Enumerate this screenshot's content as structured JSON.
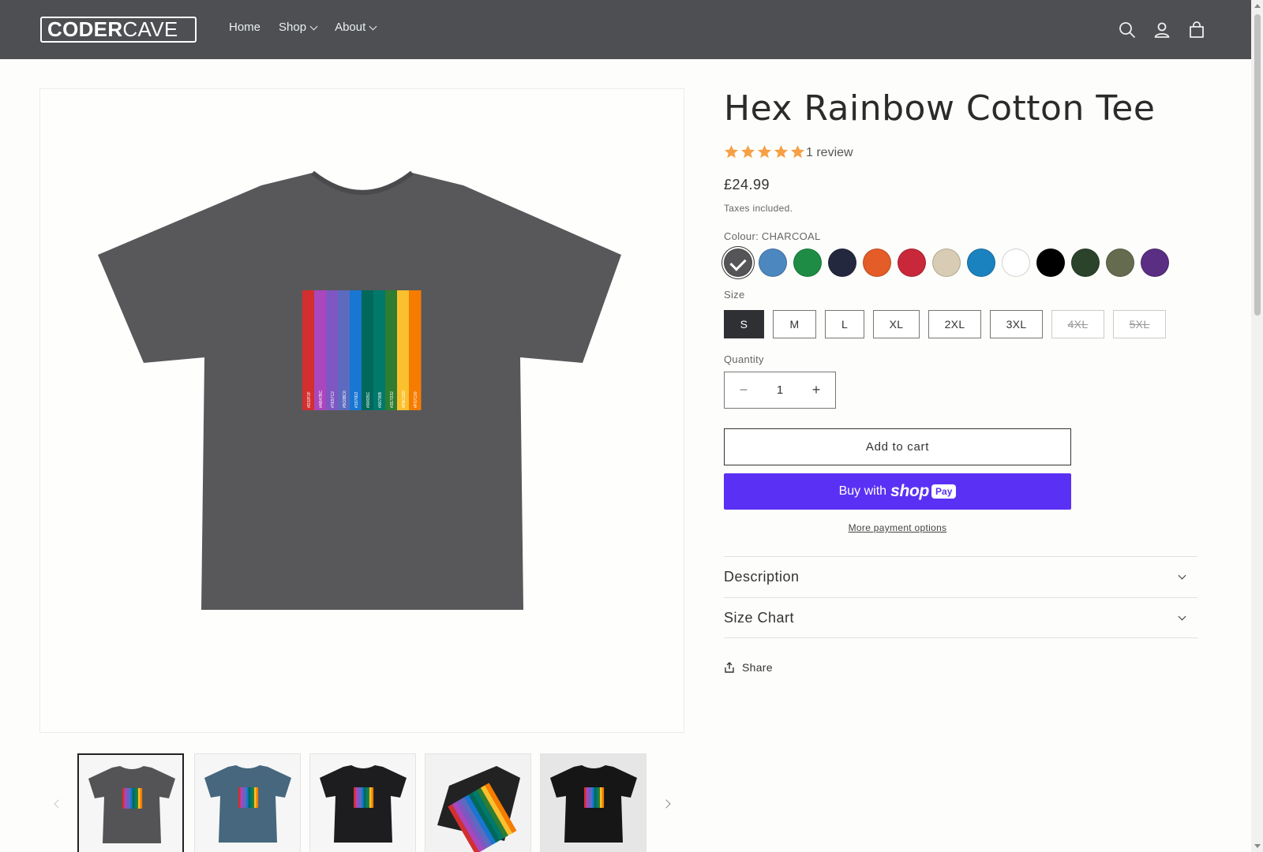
{
  "header": {
    "logo_bold": "CODER",
    "logo_light": "CAVE",
    "nav": [
      {
        "label": "Home"
      },
      {
        "label": "Shop"
      },
      {
        "label": "About"
      }
    ],
    "icons": [
      "search-icon",
      "account-icon",
      "cart-icon"
    ],
    "bg_color": "#4d4f52"
  },
  "product": {
    "title": "Hex Rainbow Cotton Tee",
    "rating": 5,
    "reviews": "1 review",
    "price": "£24.99",
    "taxes": "Taxes included.",
    "colour_label": "Colour: CHARCOAL",
    "colours": [
      "#555558",
      "#4c87bf",
      "#1e8c45",
      "#23283f",
      "#e45c27",
      "#c9283a",
      "#d8ccb4",
      "#1b82c0",
      "#ffffff",
      "#000000",
      "#2b432b",
      "#656b4f",
      "#5a2e82"
    ],
    "selected_colour": "charcoal",
    "size_label": "Size",
    "sizes": [
      "S",
      "M",
      "L",
      "XL",
      "2XL",
      "3XL",
      "4XL",
      "5XL"
    ],
    "selected_size": "S",
    "unavailable_sizes": [
      "4XL",
      "5XL"
    ],
    "quantity_label": "Quantity",
    "quantity": "1",
    "qty_minus": "−",
    "qty_plus": "+",
    "add_to_cart": "Add to cart",
    "buy_with": "Buy with",
    "shop": "shop",
    "pay": "Pay",
    "more_payment": "More payment options",
    "accordions": [
      {
        "label": "Description"
      },
      {
        "label": "Size Chart"
      }
    ],
    "share": "Share"
  },
  "gallery": {
    "stripe_colors": [
      "#d32f2f",
      "#ab47bc",
      "#7e57c2",
      "#5c6bc0",
      "#1976d2",
      "#00695c",
      "#00796b",
      "#2e7d32",
      "#fbc02d",
      "#f57c00"
    ],
    "stripe_labels": [
      "#D32F2F",
      "#AB47BC",
      "#7E57C2",
      "#5C6BC0",
      "#1976D2",
      "#00695C",
      "#00796B",
      "#2E7D32",
      "#FBC02D",
      "#F57C00"
    ],
    "thumbs": [
      {
        "shirt": "#545456",
        "bg": "#f6f6f6"
      },
      {
        "shirt": "#46677d",
        "bg": "#f6f6f6"
      },
      {
        "shirt": "#1d1d1f",
        "bg": "#f6f6f6"
      },
      {
        "shirt": "#222",
        "bg": "#f2f2f2"
      },
      {
        "shirt": "#161616",
        "bg": "#e6e6e6"
      }
    ]
  }
}
